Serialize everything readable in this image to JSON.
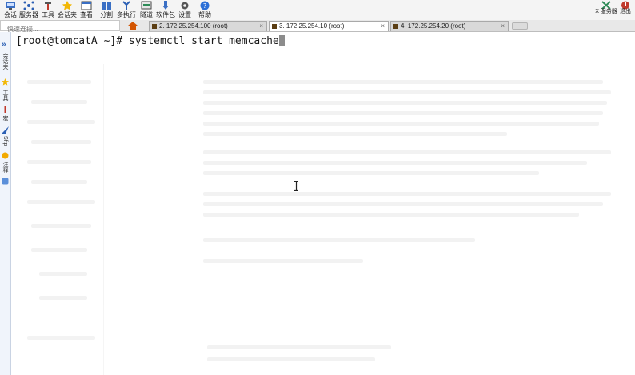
{
  "toolbar": {
    "items": [
      {
        "label": "会话",
        "icon": "session-icon"
      },
      {
        "label": "服务器",
        "icon": "server-icon"
      },
      {
        "label": "工具",
        "icon": "tools-icon"
      },
      {
        "label": "会话夹",
        "icon": "favorites-star-icon"
      },
      {
        "label": "查看",
        "icon": "view-icon"
      },
      {
        "label": "分割",
        "icon": "split-icon"
      },
      {
        "label": "多执行",
        "icon": "multi-exec-icon"
      },
      {
        "label": "隧道",
        "icon": "tunnel-icon"
      },
      {
        "label": "软件包",
        "icon": "packages-icon"
      },
      {
        "label": "设置",
        "icon": "settings-gear-icon"
      },
      {
        "label": "帮助",
        "icon": "help-icon"
      }
    ],
    "right": [
      {
        "label": "X 服务器",
        "icon": "x-server-icon"
      },
      {
        "label": "退出",
        "icon": "exit-icon"
      }
    ]
  },
  "quick_connect": {
    "placeholder": "快速连接..."
  },
  "tabs": [
    {
      "label": "2. 172.25.254.100 (root)",
      "active": false
    },
    {
      "label": "3. 172.25.254.10 (root)",
      "active": true
    },
    {
      "label": "4. 172.25.254.20 (root)",
      "active": false
    }
  ],
  "sidebar": {
    "items": [
      "会话夹",
      "工具",
      "宏",
      "Sftp",
      "注释"
    ]
  },
  "terminal": {
    "line": "[root@tomcatA ~]# systemctl start memcache"
  },
  "colors": {
    "accent": "#2b5fb4",
    "tab_icon": "#5a3d12"
  }
}
